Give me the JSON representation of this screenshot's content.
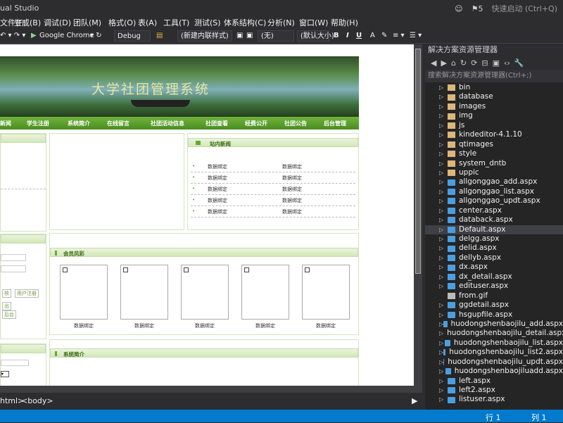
{
  "window": {
    "title": "ual Studio",
    "notif_count": "5",
    "quick_launch": "快速启动 (Ctrl+Q)"
  },
  "menu": [
    "文件(F)",
    "生成(B)",
    "调试(D)",
    "团队(M)",
    "格式(O)",
    "表(A)",
    "工具(T)",
    "测试(S)",
    "体系结构(C)",
    "分析(N)",
    "窗口(W)",
    "帮助(H)"
  ],
  "toolbar": {
    "browser": "Google Chrome",
    "config": "Debug",
    "style_combo": "(新建内联样式)",
    "target_combo": "(无)",
    "font_combo": "(默认大小)",
    "bold": "B",
    "italic": "I",
    "underline": "U"
  },
  "editor": {
    "banner_title": "大学社团管理系统",
    "nav": [
      "新闻",
      "学生注册",
      "系统简介",
      "在线留言",
      "社团活动信息",
      "社团查看",
      "经费公开",
      "社团公告",
      "后台管理"
    ],
    "site_news_title": "站内新闻",
    "news_rows": [
      [
        "数据绑定",
        "数据绑定"
      ],
      [
        "数据绑定",
        "数据绑定"
      ],
      [
        "数据绑定",
        "数据绑定"
      ],
      [
        "数据绑定",
        "数据绑定"
      ],
      [
        "数据绑定",
        "数据绑定"
      ]
    ],
    "members_title": "会员风彩",
    "member_captions": [
      "数据绑定",
      "数据绑定",
      "数据绑定",
      "数据绑定",
      "数据绑定"
    ],
    "intro_title": "系统简介",
    "left_buttons": [
      "核",
      "用户注册",
      "出",
      "后台"
    ]
  },
  "tagbar": {
    "tag1": "html>",
    "tag2": "<body>"
  },
  "status": {
    "line": "行 1",
    "col": "列 1"
  },
  "solution_explorer": {
    "title": "解决方案资源管理器",
    "search_placeholder": "搜索解决方案资源管理器(Ctrl+;)",
    "items": [
      {
        "name": "bin",
        "type": "folder"
      },
      {
        "name": "database",
        "type": "folder"
      },
      {
        "name": "images",
        "type": "folder"
      },
      {
        "name": "img",
        "type": "folder"
      },
      {
        "name": "js",
        "type": "folder"
      },
      {
        "name": "kindeditor-4.1.10",
        "type": "folder"
      },
      {
        "name": "qtimages",
        "type": "folder"
      },
      {
        "name": "style",
        "type": "folder"
      },
      {
        "name": "system_dntb",
        "type": "folder"
      },
      {
        "name": "uppic",
        "type": "folder"
      },
      {
        "name": "allgonggao_add.aspx",
        "type": "aspx"
      },
      {
        "name": "allgonggao_list.aspx",
        "type": "aspx"
      },
      {
        "name": "allgonggao_updt.aspx",
        "type": "aspx"
      },
      {
        "name": "center.aspx",
        "type": "aspx"
      },
      {
        "name": "databack.aspx",
        "type": "aspx"
      },
      {
        "name": "Default.aspx",
        "type": "aspx",
        "selected": true
      },
      {
        "name": "delgg.aspx",
        "type": "aspx"
      },
      {
        "name": "delid.aspx",
        "type": "aspx"
      },
      {
        "name": "dellyb.aspx",
        "type": "aspx"
      },
      {
        "name": "dx.aspx",
        "type": "aspx"
      },
      {
        "name": "dx_detail.aspx",
        "type": "aspx"
      },
      {
        "name": "edituser.aspx",
        "type": "aspx"
      },
      {
        "name": "from.gif",
        "type": "gif"
      },
      {
        "name": "ggdetail.aspx",
        "type": "aspx"
      },
      {
        "name": "hsgupfile.aspx",
        "type": "aspx"
      },
      {
        "name": "huodongshenbaojilu_add.aspx",
        "type": "aspx"
      },
      {
        "name": "huodongshenbaojilu_detail.aspx",
        "type": "aspx"
      },
      {
        "name": "huodongshenbaojilu_list.aspx",
        "type": "aspx"
      },
      {
        "name": "huodongshenbaojilu_list2.aspx",
        "type": "aspx"
      },
      {
        "name": "huodongshenbaojilu_updt.aspx",
        "type": "aspx"
      },
      {
        "name": "huodongshenbaojiluadd.aspx",
        "type": "aspx"
      },
      {
        "name": "left.aspx",
        "type": "aspx"
      },
      {
        "name": "left2.aspx",
        "type": "aspx"
      },
      {
        "name": "listuser.aspx",
        "type": "aspx"
      }
    ]
  }
}
